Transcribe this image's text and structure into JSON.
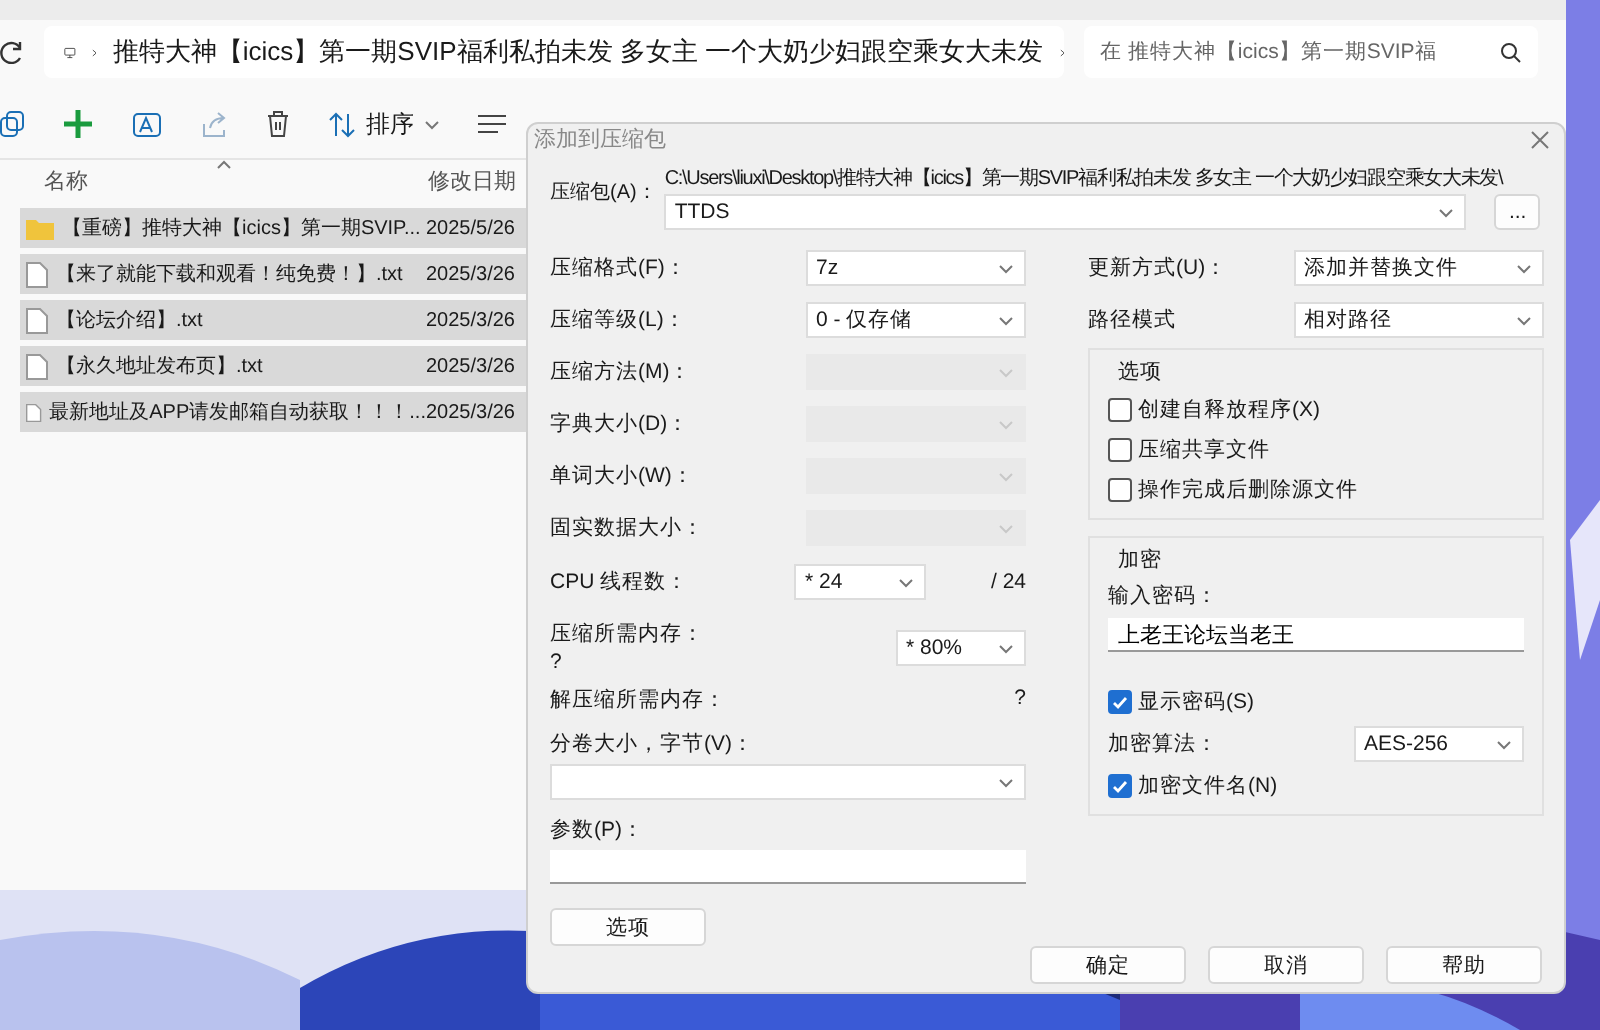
{
  "explorer": {
    "breadcrumb": "推特大神【icics】第一期SVIP福利私拍未发 多女主 一个大奶少妇跟空乘女大未发",
    "search": {
      "placeholder": "在 推特大神【icics】第一期SVIP福"
    },
    "sort_button": "排序",
    "columns": [
      "名称",
      "修改日期"
    ],
    "files": [
      {
        "kind": "folder",
        "name": "【重磅】推特大神【icics】第一期SVIP...",
        "date": "2025/5/26",
        "selected": true
      },
      {
        "kind": "file",
        "name": "【来了就能下载和观看！纯免费！】.txt",
        "date": "2025/3/26",
        "selected": true
      },
      {
        "kind": "file",
        "name": "【论坛介绍】.txt",
        "date": "2025/3/26",
        "selected": true
      },
      {
        "kind": "file",
        "name": "【永久地址发布页】.txt",
        "date": "2025/3/26",
        "selected": true
      },
      {
        "kind": "file",
        "name": "最新地址及APP请发邮箱自动获取！！！...",
        "date": "2025/3/26",
        "selected": true
      }
    ]
  },
  "dialog": {
    "title": "添加到压缩包",
    "archive": {
      "label": "压缩包(A)：",
      "path": "C:\\Users\\liuxi\\Desktop\\推特大神【icics】第一期SVIP福利私拍未发 多女主 一个大奶少妇跟空乘女大未发\\",
      "value": "TTDS",
      "browse": "..."
    },
    "left_fields": [
      {
        "label": "压缩格式(F)：",
        "value": "7z",
        "disabled": false
      },
      {
        "label": "压缩等级(L)：",
        "value": "0 - 仅存储",
        "disabled": false
      },
      {
        "label": "压缩方法(M)：",
        "disabled": true
      },
      {
        "label": "字典大小(D)：",
        "disabled": true
      },
      {
        "label": "单词大小(W)：",
        "disabled": true
      },
      {
        "label": "固实数据大小：",
        "disabled": true
      }
    ],
    "threads": {
      "label": "CPU 线程数：",
      "value": "* 24",
      "total": "/ 24"
    },
    "memory": {
      "label": "压缩所需内存：",
      "usage": "?",
      "value": "* 80%"
    },
    "decompress_memory": {
      "label": "解压缩所需内存：",
      "usage": "?"
    },
    "volume": {
      "label": "分卷大小，字节(V)："
    },
    "params": {
      "label": "参数(P)："
    },
    "options_button": "选项",
    "update_mode": {
      "label": "更新方式(U)：",
      "value": "添加并替换文件"
    },
    "path_mode": {
      "label": "路径模式",
      "value": "相对路径"
    },
    "options_group": {
      "title": "选项",
      "checkboxes": [
        {
          "label": "创建自释放程序(X)",
          "checked": false
        },
        {
          "label": "压缩共享文件",
          "checked": false
        },
        {
          "label": "操作完成后删除源文件",
          "checked": false
        }
      ]
    },
    "encryption": {
      "title": "加密",
      "password_label": "输入密码：",
      "password": "上老王论坛当老王",
      "show_password": {
        "label": "显示密码(S)",
        "checked": true
      },
      "method": {
        "label": "加密算法：",
        "value": "AES-256"
      },
      "encrypt_names": {
        "label": "加密文件名(N)",
        "checked": true
      }
    },
    "buttons": [
      "确定",
      "取消",
      "帮助"
    ]
  }
}
